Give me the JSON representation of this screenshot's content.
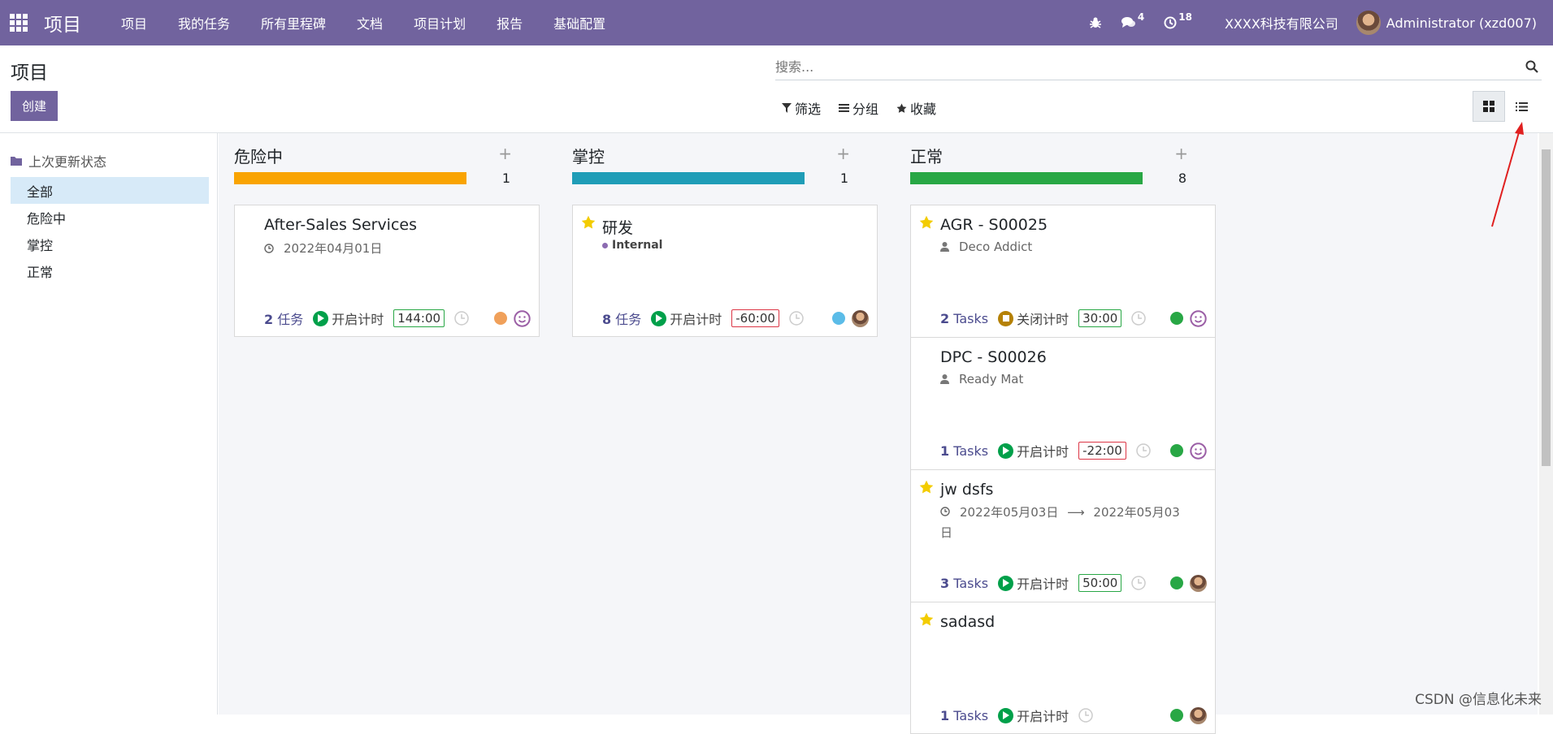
{
  "nav": {
    "brand": "项目",
    "menu": [
      "项目",
      "我的任务",
      "所有里程碑",
      "文档",
      "项目计划",
      "报告",
      "基础配置"
    ],
    "messages_count": "4",
    "activity_count": "18",
    "company": "XXXX科技有限公司",
    "user": "Administrator (xzd007)"
  },
  "control": {
    "title": "项目",
    "create_label": "创建",
    "search_placeholder": "搜索...",
    "filter_label": "筛选",
    "group_label": "分组",
    "favorite_label": "收藏"
  },
  "sidebar": {
    "header": "上次更新状态",
    "items": [
      "全部",
      "危险中",
      "掌控",
      "正常"
    ]
  },
  "columns": [
    {
      "title": "危险中",
      "count": "1",
      "color": "#f9a402",
      "cards": [
        {
          "starred": false,
          "title": "After-Sales Services",
          "subtitle": "2022年04月01日",
          "subtitle_type": "date",
          "tasks_num": "2",
          "tasks_label": "任务",
          "timer_label": "开启计时",
          "timer_state": "start",
          "time": "144:00",
          "time_status": "positive",
          "dot": "#f0a05a",
          "face": "smile"
        }
      ]
    },
    {
      "title": "掌控",
      "count": "1",
      "color": "#1f9db7",
      "cards": [
        {
          "starred": true,
          "title": "研发",
          "tag": "Internal",
          "tasks_num": "8",
          "tasks_label": "任务",
          "timer_label": "开启计时",
          "timer_state": "start",
          "time": "-60:00",
          "time_status": "negative",
          "dot": "#5bbce8",
          "face": "avatar"
        }
      ]
    },
    {
      "title": "正常",
      "count": "8",
      "color": "#28a745",
      "cards": [
        {
          "starred": true,
          "title": "AGR - S00025",
          "subtitle": "Deco Addict",
          "subtitle_type": "person",
          "tasks_num": "2",
          "tasks_label": "Tasks",
          "timer_label": "关闭计时",
          "timer_state": "stop",
          "time": "30:00",
          "time_status": "positive",
          "dot": "#28a745",
          "face": "smile"
        },
        {
          "starred": false,
          "title": "DPC - S00026",
          "subtitle": "Ready Mat",
          "subtitle_type": "person",
          "tasks_num": "1",
          "tasks_label": "Tasks",
          "timer_label": "开启计时",
          "timer_state": "start",
          "time": "-22:00",
          "time_status": "negative",
          "dot": "#28a745",
          "face": "smile"
        },
        {
          "starred": true,
          "title": "jw dsfs",
          "subtitle": "2022年05月03日",
          "subtitle_end": "2022年05月03日",
          "subtitle_type": "daterange",
          "tasks_num": "3",
          "tasks_label": "Tasks",
          "timer_label": "开启计时",
          "timer_state": "start",
          "time": "50:00",
          "time_status": "positive",
          "dot": "#28a745",
          "face": "avatar"
        },
        {
          "starred": true,
          "title": "sadasd",
          "tasks_num": "1",
          "tasks_label": "Tasks",
          "timer_label": "开启计时",
          "timer_state": "start",
          "time": "",
          "time_status": "none",
          "dot": "#28a745",
          "face": "avatar"
        }
      ]
    }
  ],
  "watermark": "CSDN @信息化未来",
  "colors": {
    "nav": "#71639e",
    "star": "#f3cc00",
    "play": "#00a04a",
    "positive": "#28a745",
    "negative": "#dc3545"
  }
}
